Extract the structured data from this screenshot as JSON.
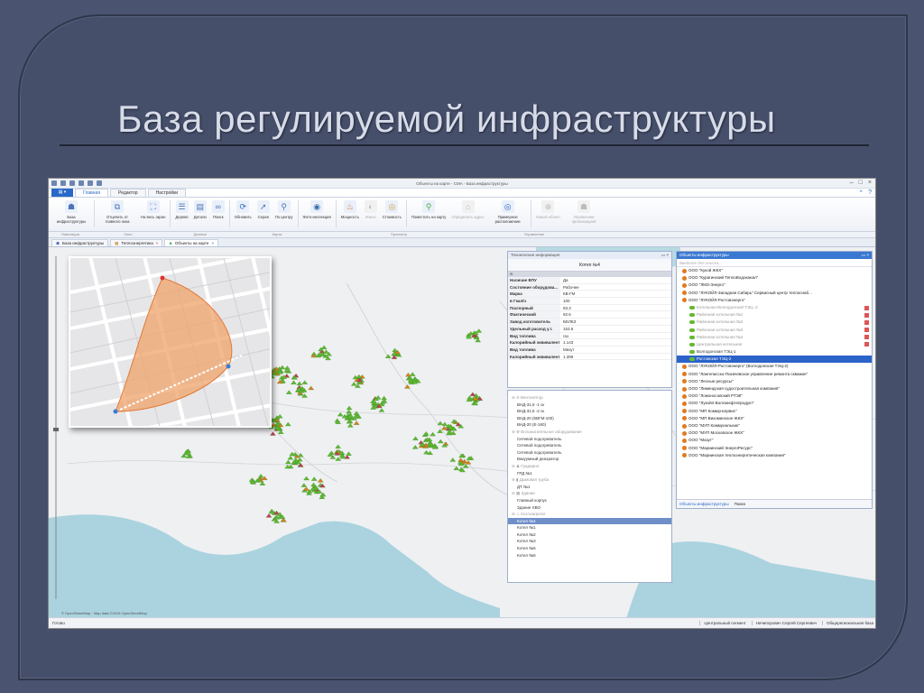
{
  "slide": {
    "title": "База регулируемой инфраструктуры"
  },
  "window": {
    "title": "Объекты на карте - СМА - База инфраструктуры"
  },
  "ribbon_tabs": [
    "Главная",
    "Редактор",
    "Настройки"
  ],
  "ribbon_buttons": [
    {
      "label": "База инфраструктуры",
      "icon": "people-icon",
      "disabled": false
    },
    {
      "label": "Отцепить от главного окна",
      "icon": "detach-icon",
      "disabled": false
    },
    {
      "label": "На весь экран",
      "icon": "fullscreen-icon",
      "disabled": false
    },
    {
      "label": "Дерево",
      "icon": "tree-icon",
      "disabled": false
    },
    {
      "label": "Детали",
      "icon": "details-icon",
      "disabled": false
    },
    {
      "label": "Поиск",
      "icon": "binoculars-icon",
      "disabled": false
    },
    {
      "label": "Обновить",
      "icon": "refresh-icon",
      "disabled": false
    },
    {
      "label": "Серая",
      "icon": "pointer-icon",
      "disabled": false
    },
    {
      "label": "По центру",
      "icon": "magnifier-icon",
      "disabled": false
    },
    {
      "label": "Фото-инспекция",
      "icon": "camera-icon",
      "disabled": false
    },
    {
      "label": "Мощность",
      "icon": "fire-icon",
      "disabled": false
    },
    {
      "label": "Износ",
      "icon": "wear-icon",
      "disabled": true
    },
    {
      "label": "Стоимость",
      "icon": "coins-icon",
      "disabled": false
    },
    {
      "label": "Поместить на карту",
      "icon": "map-pin-icon",
      "disabled": false
    },
    {
      "label": "Определить адрес",
      "icon": "tag-icon",
      "disabled": true
    },
    {
      "label": "Примерное расположение",
      "icon": "target-icon",
      "disabled": false
    },
    {
      "label": "Новый объект",
      "icon": "plus-icon",
      "disabled": true
    },
    {
      "label": "Управление организацией",
      "icon": "org-icon",
      "disabled": true
    }
  ],
  "ribbon_groups": [
    "Навигация",
    "Окно",
    "Данные",
    "Карта",
    "Просмотр",
    "Управление"
  ],
  "doc_tabs": [
    "База инфраструктуры",
    "Теплоэнергетика",
    "Объекты на карте"
  ],
  "tech_panel": {
    "header": "Технические информация",
    "title": "Котел №4",
    "props": [
      {
        "k": "Наличие ВПУ",
        "v": "Да"
      },
      {
        "k": "Состояние оборудова...",
        "v": "Рабочее"
      },
      {
        "k": "Марка",
        "v": "КВ-ГМ"
      },
      {
        "k": "в Гкал/ч",
        "v": "100"
      },
      {
        "k": "Паспорный",
        "v": "93.3"
      },
      {
        "k": "Фактический",
        "v": "92.6"
      },
      {
        "k": "Завод изготовитель",
        "v": "БЕЛКЗ"
      },
      {
        "k": "Удельный расход у.т.",
        "v": "153.6"
      },
      {
        "k": "Вид топлива",
        "v": "газ"
      },
      {
        "k": "Калорийный эквивалент",
        "v": "1.143"
      },
      {
        "k": "Вид топлива",
        "v": "Мазут"
      },
      {
        "k": "Калорийный эквивалент",
        "v": "1.399"
      }
    ],
    "tree": [
      {
        "t": "⊖ ≋ Вентилятор",
        "c": "sec"
      },
      {
        "t": "ВНД-31,5 -1 ск",
        "c": ""
      },
      {
        "t": "ВНД-31,5 -2 ск",
        "c": ""
      },
      {
        "t": "ВНД-20 (КВГМ-100)",
        "c": ""
      },
      {
        "t": "ВНД-20 (Е-160)",
        "c": ""
      },
      {
        "t": "⊖ ⚙ Вспомогательное оборудование",
        "c": "sec"
      },
      {
        "t": "Сетевой подогреватель",
        "c": ""
      },
      {
        "t": "Сетевой подогреватель",
        "c": ""
      },
      {
        "t": "Сетевой подогреватель",
        "c": ""
      },
      {
        "t": "Вакуумный деаэратор",
        "c": ""
      },
      {
        "t": "⊖ ♟ Градирня",
        "c": "sec"
      },
      {
        "t": "ГРД №1",
        "c": ""
      },
      {
        "t": "⊖ ▮ Дымовая труба",
        "c": "sec"
      },
      {
        "t": "ДТ №1",
        "c": ""
      },
      {
        "t": "⊖ ▦ Здание",
        "c": "sec"
      },
      {
        "t": "Главный корпус",
        "c": ""
      },
      {
        "t": "Здание ХВО",
        "c": ""
      },
      {
        "t": "⊖ ♨ Котлоагрегат",
        "c": "sec"
      },
      {
        "t": "Котел №4",
        "c": "sel"
      },
      {
        "t": "Котел №1",
        "c": ""
      },
      {
        "t": "Котел №2",
        "c": ""
      },
      {
        "t": "Котел №3",
        "c": ""
      },
      {
        "t": "Котел №5",
        "c": ""
      },
      {
        "t": "Котел №6",
        "c": ""
      }
    ]
  },
  "objects_panel": {
    "header": "Объекты инфраструктуры",
    "search_placeholder": "Введите для поиска...",
    "items": [
      {
        "t": "ООО \"Кукой ЖКХ\"",
        "c": ""
      },
      {
        "t": "ООО \"Курагинский ТеплоВодоканал\"",
        "c": ""
      },
      {
        "t": "ООО \"ЛМЗ-Энерго\"",
        "c": ""
      },
      {
        "t": "ООО \"ЛУКОЙЛ-Западная Сибирь\" Сервисный центр теплоснаб...",
        "c": ""
      },
      {
        "t": "ООО \"ЛУКОЙЛ-Ростовэнерго\"",
        "c": ""
      },
      {
        "t": "Котельная Волгодонской ТЭЦ -2",
        "c": "sub"
      },
      {
        "t": "Районная котельная №1",
        "c": "sub"
      },
      {
        "t": "Районная котельная №2",
        "c": "sub"
      },
      {
        "t": "Районная котельная №3",
        "c": "sub"
      },
      {
        "t": "Районная котельная №4",
        "c": "sub"
      },
      {
        "t": "Центральная котельная",
        "c": "sub"
      },
      {
        "t": "Волгодонская ТЭЦ-1",
        "c": "sub2"
      },
      {
        "t": "Ростовская ТЭЦ-2",
        "c": "sel"
      },
      {
        "t": "ООО \"ЛУКОЙЛ-Ростовэнерго\" (Волгодонская ТЭЦ-2)",
        "c": ""
      },
      {
        "t": "ООО \"Лангепасско-Покачевское управление ремонта скважин\"",
        "c": ""
      },
      {
        "t": "ООО \"Лесные ресурсы\"",
        "c": ""
      },
      {
        "t": "ООО \"Лимендская судостроительная компания\"",
        "c": ""
      },
      {
        "t": "ООО \"Ломоносовский РТЭК\"",
        "c": ""
      },
      {
        "t": "ООО \"Лукойл-Волганефтепродукт\"",
        "c": ""
      },
      {
        "t": "ООО \"МП Коммунсервис\"",
        "c": ""
      },
      {
        "t": "ООО \"МП Вихоминское ЖКХ\"",
        "c": ""
      },
      {
        "t": "ООО \"МУП Коммунальник\"",
        "c": ""
      },
      {
        "t": "ООО \"МУП Московское ЖКХ\"",
        "c": ""
      },
      {
        "t": "ООО \"Мазут\"",
        "c": ""
      },
      {
        "t": "ООО \"Мариинский ЭнергоРесурс\"",
        "c": ""
      },
      {
        "t": "ООО \"Мариинская теплоэнергетическая компания\"",
        "c": ""
      }
    ],
    "tabs": [
      "Объекты инфраструктуры",
      "Поиск"
    ]
  },
  "map": {
    "attribution": "© OpenStreetMap · Map data ©2015 OpenStreetMap"
  },
  "status": {
    "left": "Готово",
    "right": [
      "Центральный сегмент",
      "Ничипорович Сергей Сергеевич",
      "Общерегиональная база"
    ]
  }
}
